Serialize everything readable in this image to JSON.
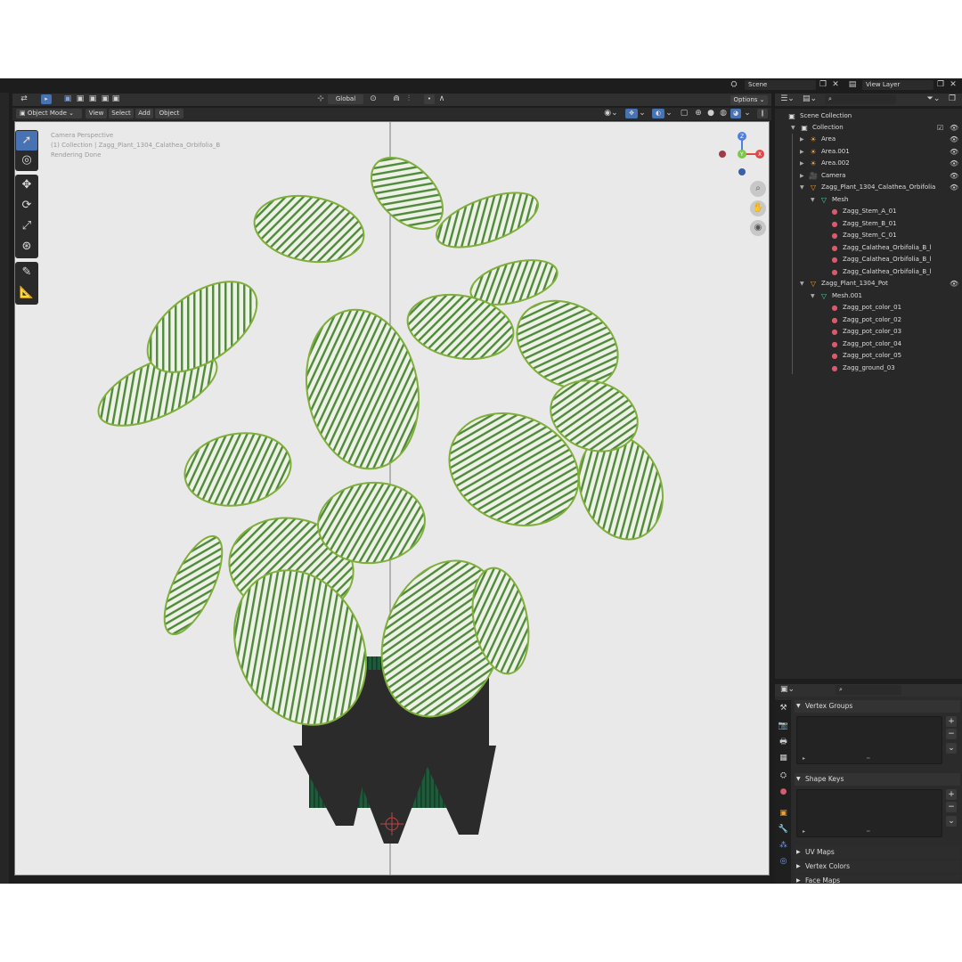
{
  "topbar": {
    "scene_label": "Scene",
    "view_layer_label": "View Layer"
  },
  "viewport_header": {
    "transform_orientation": "Global",
    "mode": "Object Mode",
    "menus": [
      "View",
      "Select",
      "Add",
      "Object"
    ],
    "options_label": "Options"
  },
  "viewport": {
    "line1": "Camera Perspective",
    "line2": "(1) Collection | Zagg_Plant_1304_Calathea_Orbifolia_B",
    "line3": "Rendering Done",
    "gizmo": {
      "z": "Z",
      "x": "X",
      "y": "Y"
    }
  },
  "outliner": {
    "scene_collection": "Scene Collection",
    "collection": "Collection",
    "objects": [
      {
        "label": "Area",
        "indent": 2,
        "icon": "light-icon"
      },
      {
        "label": "Area.001",
        "indent": 2,
        "icon": "light-icon"
      },
      {
        "label": "Area.002",
        "indent": 2,
        "icon": "light-icon"
      },
      {
        "label": "Camera",
        "indent": 2,
        "icon": "camera-icon"
      },
      {
        "label": "Zagg_Plant_1304_Calathea_Orbifolia",
        "indent": 2,
        "icon": "mesh-object-icon"
      },
      {
        "label": "Mesh",
        "indent": 3,
        "icon": "mesh-data-icon"
      },
      {
        "label": "Zagg_Stem_A_01",
        "indent": 4,
        "icon": "material-icon"
      },
      {
        "label": "Zagg_Stem_B_01",
        "indent": 4,
        "icon": "material-icon"
      },
      {
        "label": "Zagg_Stem_C_01",
        "indent": 4,
        "icon": "material-icon"
      },
      {
        "label": "Zagg_Calathea_Orbifolia_B_l",
        "indent": 4,
        "icon": "material-icon"
      },
      {
        "label": "Zagg_Calathea_Orbifolia_B_l",
        "indent": 4,
        "icon": "material-icon"
      },
      {
        "label": "Zagg_Calathea_Orbifolia_B_l",
        "indent": 4,
        "icon": "material-icon"
      },
      {
        "label": "Zagg_Plant_1304_Pot",
        "indent": 2,
        "icon": "mesh-object-icon"
      },
      {
        "label": "Mesh.001",
        "indent": 3,
        "icon": "mesh-data-icon"
      },
      {
        "label": "Zagg_pot_color_01",
        "indent": 4,
        "icon": "material-icon"
      },
      {
        "label": "Zagg_pot_color_02",
        "indent": 4,
        "icon": "material-icon"
      },
      {
        "label": "Zagg_pot_color_03",
        "indent": 4,
        "icon": "material-icon"
      },
      {
        "label": "Zagg_pot_color_04",
        "indent": 4,
        "icon": "material-icon"
      },
      {
        "label": "Zagg_pot_color_05",
        "indent": 4,
        "icon": "material-icon"
      },
      {
        "label": "Zagg_ground_03",
        "indent": 4,
        "icon": "material-icon"
      }
    ]
  },
  "properties": {
    "vertex_groups": "Vertex Groups",
    "shape_keys": "Shape Keys",
    "uv_maps": "UV Maps",
    "vertex_colors": "Vertex Colors",
    "face_maps": "Face Maps"
  },
  "colors": {
    "accent": "#4772b3",
    "light_icon": "#e8a24a",
    "material_icon": "#d75a6d",
    "mesh_icon": "#4fd1a1",
    "object_icon": "#f0a030"
  }
}
